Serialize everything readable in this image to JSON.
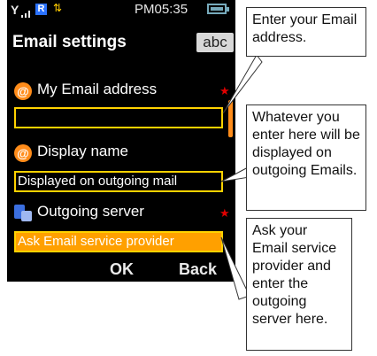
{
  "status_bar": {
    "time": "PM05:35",
    "r_badge": "R"
  },
  "header": {
    "title": "Email settings",
    "input_mode": "abc"
  },
  "fields": [
    {
      "label": "My Email address",
      "value": "",
      "required": true,
      "icon": "at-icon"
    },
    {
      "label": "Display name",
      "value": "Displayed on outgoing mail",
      "required": false,
      "icon": "at-icon"
    },
    {
      "label": "Outgoing server",
      "value": "Ask Email service provider",
      "required": true,
      "icon": "server-icon"
    }
  ],
  "softkeys": {
    "left": "OK",
    "right": "Back"
  },
  "callouts": [
    "Enter your Email address.",
    "Whatever you enter here will be displayed on outgoing Emails.",
    "Ask your Email service provider and enter the outgoing server here."
  ],
  "colors": {
    "accent": "#ffa000",
    "border": "#ffd200",
    "required": "#e00000"
  }
}
